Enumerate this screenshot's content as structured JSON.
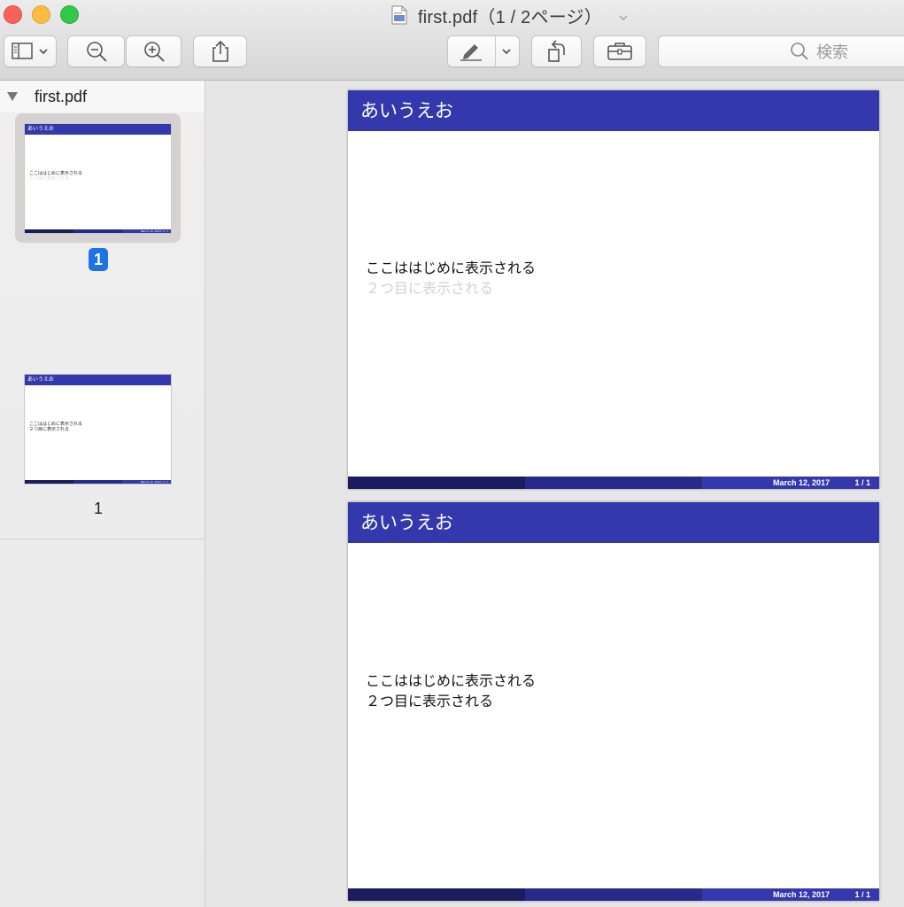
{
  "window": {
    "title": "first.pdf（1 / 2ページ）",
    "search_placeholder": "検索"
  },
  "toolbar": {
    "buttons": [
      "sidebar-toggle-icon",
      "zoom-out-icon",
      "zoom-in-icon",
      "share-icon",
      "markup-pen-icon",
      "rotate-icon",
      "toolbox-icon"
    ]
  },
  "sidebar": {
    "doc_name": "first.pdf",
    "thumbnails": [
      {
        "header": "あいうえお",
        "line1": "ここははじめに表示される",
        "line2": "２つ目に表示される",
        "footer": "March 12, 2017   1 / 1",
        "page_label": "1"
      },
      {
        "header": "あいうえお",
        "line1": "ここははじめに表示される",
        "line2": "２つ目に表示される",
        "footer": "March 12, 2017   1 / 1",
        "page_label": "1"
      }
    ]
  },
  "pages": [
    {
      "header": "あいうえお",
      "line1": "ここははじめに表示される",
      "line2": "２つ目に表示される",
      "line2_color": "#d2d2d2",
      "date": "March 12, 2017",
      "page": "1 / 1"
    },
    {
      "header": "あいうえお",
      "line1": "ここははじめに表示される",
      "line2": "２つ目に表示される",
      "line2_color": "#111111",
      "date": "March 12, 2017",
      "page": "1 / 1"
    }
  ],
  "colors": {
    "beamer_header": "#3339ad",
    "footer_dark": "#1a1c5e",
    "footer_mid": "#262a8a",
    "footer_light": "#3339ad",
    "selection_badge": "#1c73e8"
  }
}
